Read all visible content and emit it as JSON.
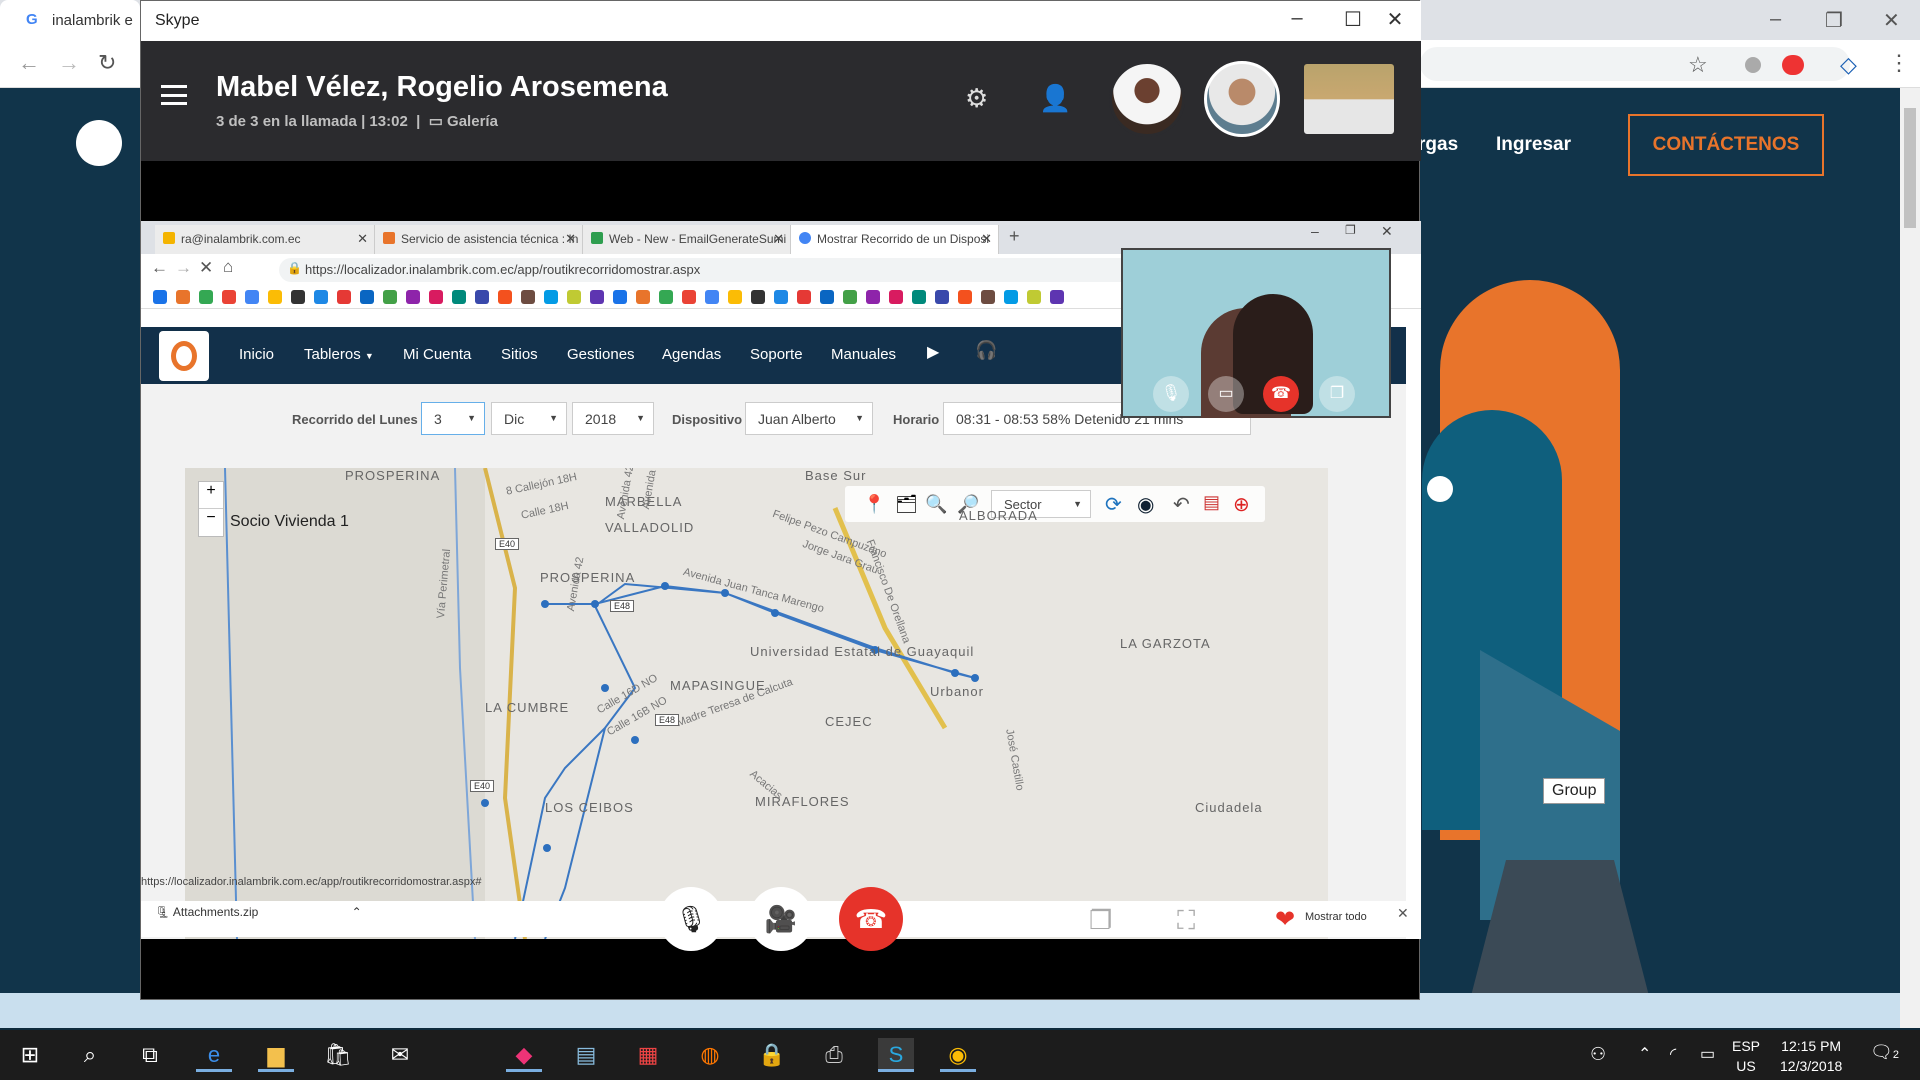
{
  "background_browser": {
    "tab_title": "inalambrik e",
    "nav": {
      "item1": "rgas",
      "item2": "Ingresar",
      "contact": "CONTÁCTENOS"
    },
    "tooltip": "Group"
  },
  "skype": {
    "window_title": "Skype",
    "call_title": "Mabel Vélez, Rogelio Arosemena",
    "call_info": "3 de 3 en la llamada | 13:02",
    "view_mode": "Galería",
    "controls": {
      "mic": "microphone-icon",
      "video": "video-camera-icon",
      "hangup": "hang-up-icon",
      "react_label": "Mostrar todo"
    },
    "download_item": "Attachments.zip"
  },
  "shared_browser": {
    "tabs": [
      {
        "title": "ra@inalambrik.com.ec",
        "color": "#f4b400"
      },
      {
        "title": "Servicio de asistencia técnica : In",
        "color": "#e8742b"
      },
      {
        "title": "Web - New - EmailGenerateSumi",
        "color": "#2e9e4f"
      },
      {
        "title": "Mostrar Recorrido de un Disposi",
        "color": "#4285f4"
      }
    ],
    "url": "https://localizador.inalambrik.com.ec/app/routikrecorridomostrar.aspx",
    "status_url": "https://localizador.inalambrik.com.ec/app/routikrecorridomostrar.aspx#",
    "app_nav": [
      "Inicio",
      "Tableros",
      "Mi Cuenta",
      "Sitios",
      "Gestiones",
      "Agendas",
      "Soporte",
      "Manuales"
    ],
    "form": {
      "label_route": "Recorrido del Lunes",
      "day": "3",
      "month": "Dic",
      "year": "2018",
      "label_device": "Dispositivo",
      "device": "Juan Alberto",
      "label_schedule": "Horario",
      "schedule": "08:31 - 08:53 58% Detenido 21 mins"
    },
    "map": {
      "layer_select": "Sector",
      "overlay_label": "Socio Vivienda 1",
      "places": [
        "PROSPERINA",
        "MARBELLA",
        "VALLADOLID",
        "ALBORADA",
        "PROSPERINA",
        "Universidad Estatal de Guayaquil",
        "MAPASINGUE",
        "LA GARZOTA",
        "LA CUMBRE",
        "Urbanor",
        "CEJEC",
        "MIRAFLORES",
        "LOS CEIBOS",
        "Ciudadela",
        "Base Sur"
      ],
      "streets": [
        "8 Callejón 18H",
        "Calle 18H",
        "Avenida 40 NO",
        "Avenida 42A",
        "Felipe Pezo Campuzano",
        "Jorge Jara Grau",
        "Francisco De Orellana",
        "Avenida Juan Tanca Marengo",
        "Vía Perimetral",
        "Avenida 42",
        "Calle 16D NO",
        "Calle 16B NO",
        "Madre Teresa de Calcuta",
        "José Castillo",
        "Acacias"
      ],
      "road_badges": [
        "E40",
        "E48",
        "E48",
        "E40"
      ]
    }
  },
  "taskbar": {
    "lang1": "ESP",
    "lang2": "US",
    "time": "12:15 PM",
    "date": "12/3/2018",
    "notifications": "2"
  }
}
